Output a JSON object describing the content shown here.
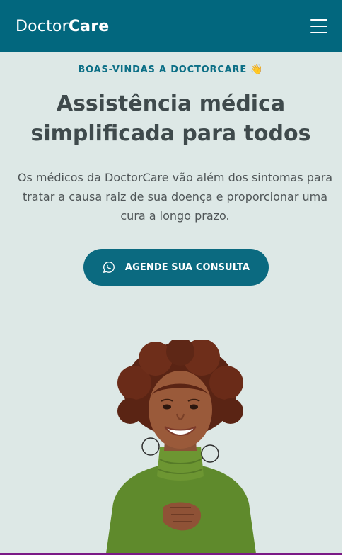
{
  "header": {
    "logo_light": "Doctor",
    "logo_bold": "Care",
    "menu_icon": "hamburger-icon",
    "background_color": "#02677e"
  },
  "hero": {
    "eyebrow": "BOAS-VINDAS A DOCTORCARE",
    "eyebrow_emoji": "👋",
    "title": "Assistência médica simplificada para todos",
    "description": "Os médicos da DoctorCare vão além dos sintomas para tratar a causa raiz de sua doença e proporcionar uma cura a longo prazo.",
    "cta_label": "AGENDE SUA CONSULTA",
    "cta_icon": "whatsapp-icon",
    "cta_color": "#0b6a80",
    "image_icon": "smiling-woman-photo"
  },
  "colors": {
    "page_background": "#dde8e6",
    "accent": "#0c6f86",
    "heading_text": "#3f4a4c"
  }
}
